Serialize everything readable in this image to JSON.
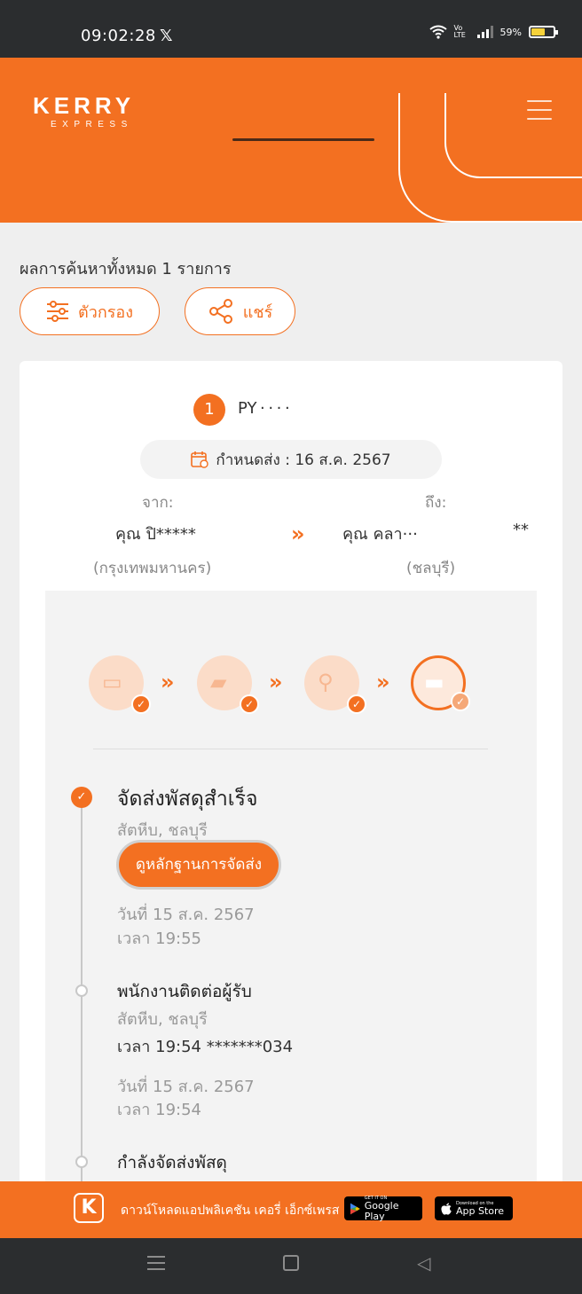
{
  "status_bar": {
    "time": "09:02:28",
    "x_app_glyph": "𝕏",
    "net_label": "Vo LTE",
    "battery": "59%"
  },
  "header": {
    "logo_main": "KERRY",
    "logo_sub": "EXPRESS"
  },
  "results": {
    "summary": "ผลการค้นหาทั้งหมด 1 รายการ",
    "filter_label": "ตัวกรอง",
    "share_label": "แชร์"
  },
  "shipment": {
    "index": "1",
    "tracking_no": "PY · · · ·",
    "due_date": "กำหนดส่ง : 16 ส.ค. 2567",
    "from_label": "จาก:",
    "to_label": "ถึง:",
    "sender_name": "คุณ ปิ*****",
    "receiver_name": "คุณ คลา···",
    "receiver_mask": "**",
    "sender_city": "(กรุงเทพมหานคร)",
    "receiver_city": "(ชลบุรี)",
    "route_arrow": "»"
  },
  "progress_steps": [
    {
      "icon": "package-pickup-icon",
      "status": "done"
    },
    {
      "icon": "truck-icon",
      "status": "done"
    },
    {
      "icon": "scooter-icon",
      "status": "done"
    },
    {
      "icon": "delivered-box-icon",
      "status": "current"
    }
  ],
  "events": [
    {
      "title": "จัดส่งพัสดุสำเร็จ",
      "location": "สัตหีบ, ชลบุรี",
      "button": "ดูหลักฐานการจัดส่ง",
      "date": "วันที่ 15 ส.ค. 2567",
      "time": "เวลา 19:55"
    },
    {
      "title": "พนักงานติดต่อผู้รับ",
      "location": "สัตหีบ, ชลบุรี",
      "note": "เวลา 19:54 *******034",
      "date": "วันที่ 15 ส.ค. 2567",
      "time": "เวลา 19:54"
    },
    {
      "title": "กำลังจัดส่งพัสดุ"
    }
  ],
  "app_banner": {
    "logo_letter": "K",
    "text": "ดาวน์โหลดแอปพลิเคชัน เคอรี่ เอ็กซ์เพรส",
    "google_small": "GET IT ON",
    "google_big": "Google Play",
    "apple_small": "Download on the",
    "apple_big": "App Store"
  }
}
